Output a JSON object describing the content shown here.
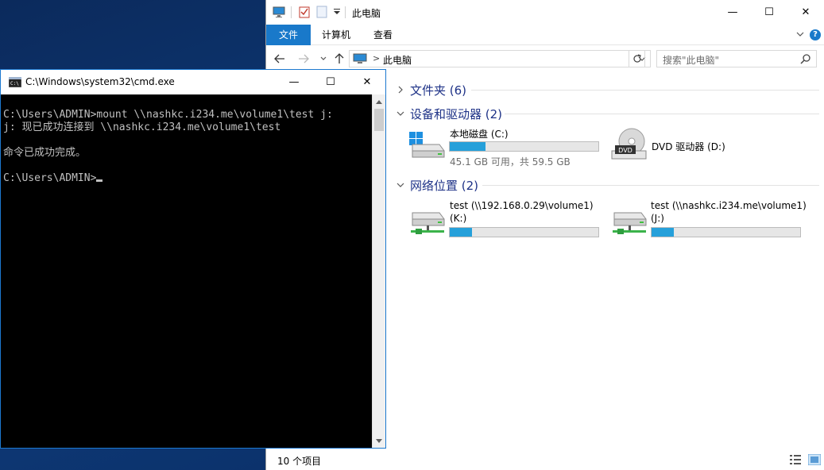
{
  "explorer": {
    "title": "此电脑",
    "window_buttons": {
      "minimize": "—",
      "maximize": "☐",
      "close": "✕"
    },
    "ribbon": {
      "tabs": [
        "文件",
        "计算机",
        "查看"
      ],
      "help": "?"
    },
    "address": {
      "path": "此电脑",
      "separator": ">"
    },
    "search": {
      "placeholder": "搜索\"此电脑\""
    },
    "groups": {
      "folders": "文件夹 (6)",
      "devices": "设备和驱动器 (2)",
      "network": "网络位置 (2)"
    },
    "drives": [
      {
        "name": "本地磁盘 (C:)",
        "free_text": "45.1 GB 可用，共 59.5 GB",
        "used_fraction": 0.24
      },
      {
        "name": "DVD 驱动器 (D:)",
        "label": "DVD"
      }
    ],
    "network_locations": [
      {
        "name": "test (\\\\192.168.0.29\\volume1)",
        "letter": "(K:)",
        "used_fraction": 0.15
      },
      {
        "name": "test (\\\\nashkc.i234.me\\volume1)",
        "letter": "(J:)",
        "used_fraction": 0.15
      }
    ],
    "status": {
      "items": "10 个项目"
    },
    "colors": {
      "accent": "#1979ca",
      "bar_fill": "#26a0da",
      "group_title": "#1e3287"
    }
  },
  "cmd": {
    "title": "C:\\Windows\\system32\\cmd.exe",
    "icon_label": "C:\\",
    "window_buttons": {
      "minimize": "—",
      "maximize": "☐",
      "close": "✕"
    },
    "lines": [
      "C:\\Users\\ADMIN>mount \\\\nashkc.i234.me\\volume1\\test j:",
      "j: 现已成功连接到 \\\\nashkc.i234.me\\volume1\\test",
      "",
      "命令已成功完成。",
      "",
      "C:\\Users\\ADMIN>"
    ]
  }
}
